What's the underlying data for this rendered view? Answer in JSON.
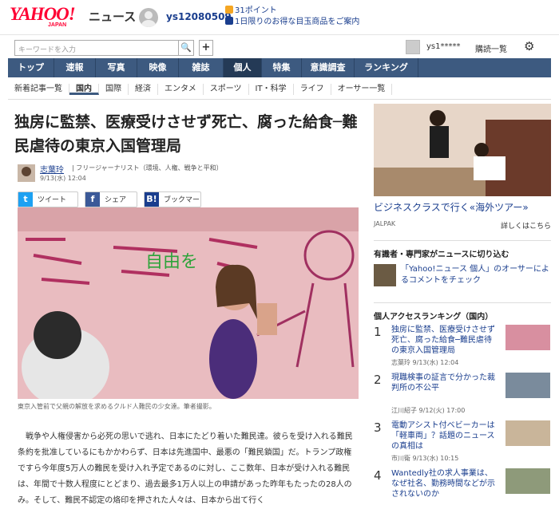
{
  "header": {
    "logo": "YAHOO!",
    "logo_sub": "JAPAN",
    "section": "ニュース",
    "username": "ys12080509",
    "points": "31ポイント",
    "promo": "1日限りのお得な目玉商品をご案内"
  },
  "search": {
    "placeholder": "キーワードを入力",
    "plus": "+"
  },
  "account": {
    "name": "ys1*****",
    "subscription": "購読一覧"
  },
  "nav": {
    "items": [
      "トップ",
      "速報",
      "写真",
      "映像",
      "雑誌",
      "個人",
      "特集",
      "意識調査",
      "ランキング"
    ],
    "active": 5
  },
  "subnav": {
    "items": [
      "新着記事一覧",
      "国内",
      "国際",
      "経済",
      "エンタメ",
      "スポーツ",
      "IT・科学",
      "ライフ",
      "オーサー一覧"
    ],
    "active": 1
  },
  "article": {
    "title": "独房に監禁、医療受けさせず死亡、腐った給食─難民虐待の東京入国管理局",
    "author": "志葉玲",
    "role": "| フリージャーナリスト（環境、人権、戦争と平和）",
    "date": "9/13(水) 12:04",
    "share": {
      "tweet": "ツイート",
      "facebook": "シェア",
      "bookmark": "ブックマーク"
    },
    "caption": "東京入管前で父親の解放を求めるクルド人難民の少女達。筆者撮影。",
    "body": "　戦争や人権侵害から必死の思いで逃れ、日本にたどり着いた難民達。彼らを受け入れる難民条約を批准しているにもかかわらず、日本は先進国中、最悪の「難民鎖国」だ。トランプ政権ですら今年度5万人の難民を受け入れ予定であるのに対し、ここ数年、日本が受け入れる難民は、年間で十数人程度にとどまり、過去最多1万人以上の申請があった昨年もたったの28人のみ。そして、難民不認定の烙印を押された人々は、日本から出て行く"
  },
  "sidebar": {
    "ad": {
      "title": "ビジネスクラスで行く«海外ツアー»",
      "source": "JALPAK",
      "more": "詳しくはこちら"
    },
    "expert_title": "有識者・専門家がニュースに切り込む",
    "expert_text": "「Yahoo!ニュース 個人」のオーサーによるコメントをチェック",
    "ranking_title": "個人アクセスランキング（国内）",
    "ranking": [
      {
        "num": "1",
        "title": "独房に監禁、医療受けさせず死亡、腐った給食─難民虐待の東京入国管理局",
        "meta": "志葉玲 9/13(水) 12:04"
      },
      {
        "num": "2",
        "title": "現職検事の証言で分かった裁判所の不公平",
        "meta": "江川紹子 9/12(火) 17:00"
      },
      {
        "num": "3",
        "title": "電動アシスト付ベビーカーは「軽車両」？話題のニュースの真相は",
        "meta": "市川衛 9/13(水) 10:15"
      },
      {
        "num": "4",
        "title": "Wantedly社の求人事業は、なぜ社名、勤務時間などが示されないのか",
        "meta": ""
      }
    ]
  }
}
